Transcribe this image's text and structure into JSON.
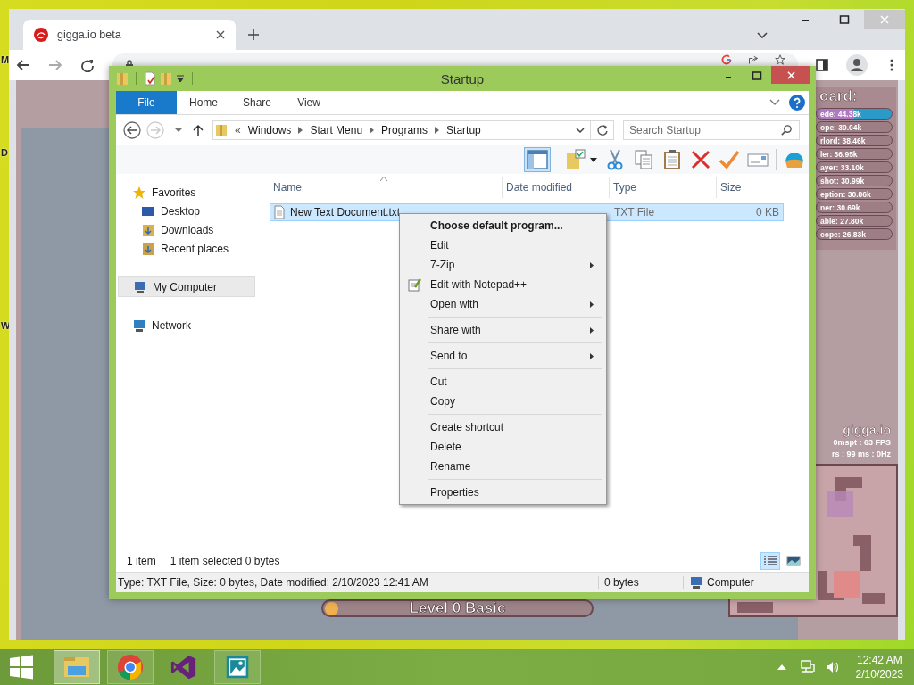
{
  "desktop": {
    "icon_labels": [
      "M",
      "D",
      "W"
    ]
  },
  "browser": {
    "tabs": [
      {
        "title": "gigga.io beta",
        "selected": true
      }
    ],
    "game": {
      "leaderboard": {
        "title": "oard:",
        "entries": [
          {
            "text": "ede: 44.38k",
            "selected": true
          },
          {
            "text": "ope: 39.04k",
            "selected": false
          },
          {
            "text": "rlord: 38.46k",
            "selected": false
          },
          {
            "text": "ler: 36.95k",
            "selected": false
          },
          {
            "text": "ayer: 33.10k",
            "selected": false
          },
          {
            "text": "shot: 30.99k",
            "selected": false
          },
          {
            "text": "eption: 30.86k",
            "selected": false
          },
          {
            "text": "ner: 30.69k",
            "selected": false
          },
          {
            "text": "able: 27.80k",
            "selected": false
          },
          {
            "text": "cope: 26.83k",
            "selected": false
          }
        ]
      },
      "brand": "gigga.io",
      "stats": [
        "0mspt : 63 FPS",
        "rs : 99 ms : 0Hz"
      ],
      "level_label": "Level 0 Basic"
    }
  },
  "explorer": {
    "title": "Startup",
    "ribbon_tabs": [
      {
        "label": "File",
        "selected": true
      },
      {
        "label": "Home",
        "selected": false
      },
      {
        "label": "Share",
        "selected": false
      },
      {
        "label": "View",
        "selected": false
      }
    ],
    "breadcrumb_overflow": "«",
    "breadcrumb": [
      "Windows",
      "Start Menu",
      "Programs",
      "Startup"
    ],
    "search": {
      "placeholder": "Search Startup"
    },
    "nav": [
      {
        "label": "Favorites",
        "kind": "favorites",
        "selected": false,
        "children": [
          {
            "label": "Desktop",
            "kind": "desktop",
            "selected": false
          },
          {
            "label": "Downloads",
            "kind": "downloads",
            "selected": false
          },
          {
            "label": "Recent places",
            "kind": "recent",
            "selected": false
          }
        ]
      },
      {
        "label": "My Computer",
        "kind": "computer",
        "selected": true
      },
      {
        "label": "Network",
        "kind": "network",
        "selected": false
      }
    ],
    "columns": [
      "Name",
      "Date modified",
      "Type",
      "Size"
    ],
    "files": [
      {
        "name": "New Text Document.txt",
        "type": "TXT File",
        "size": "0 KB",
        "selected": true
      }
    ],
    "item_count": "1 item",
    "selection_info": "1 item selected  0 bytes",
    "view_modes": [
      {
        "kind": "details",
        "selected": true
      },
      {
        "kind": "icons",
        "selected": false
      }
    ],
    "details": "Type: TXT File, Size: 0 bytes, Date modified: 2/10/2023 12:41 AM",
    "details_size": "0 bytes",
    "details_location": "Computer"
  },
  "context_menu": {
    "groups": [
      [
        {
          "label": "Choose default program...",
          "default": true,
          "submenu": false,
          "has_icon": false
        },
        {
          "label": "Edit",
          "default": false,
          "submenu": false,
          "has_icon": false
        },
        {
          "label": "7-Zip",
          "default": false,
          "submenu": true,
          "has_icon": false
        },
        {
          "label": "Edit with Notepad++",
          "default": false,
          "submenu": false,
          "has_icon": true
        },
        {
          "label": "Open with",
          "default": false,
          "submenu": true,
          "has_icon": false
        }
      ],
      [
        {
          "label": "Share with",
          "default": false,
          "submenu": true,
          "has_icon": false
        }
      ],
      [
        {
          "label": "Send to",
          "default": false,
          "submenu": true,
          "has_icon": false
        }
      ],
      [
        {
          "label": "Cut",
          "default": false,
          "submenu": false,
          "has_icon": false
        },
        {
          "label": "Copy",
          "default": false,
          "submenu": false,
          "has_icon": false
        }
      ],
      [
        {
          "label": "Create shortcut",
          "default": false,
          "submenu": false,
          "has_icon": false
        },
        {
          "label": "Delete",
          "default": false,
          "submenu": false,
          "has_icon": false
        },
        {
          "label": "Rename",
          "default": false,
          "submenu": false,
          "has_icon": false
        }
      ],
      [
        {
          "label": "Properties",
          "default": false,
          "submenu": false,
          "has_icon": false
        }
      ]
    ]
  },
  "taskbar": {
    "apps": [
      {
        "kind": "explorer",
        "running": true,
        "active": true
      },
      {
        "kind": "chrome",
        "running": true,
        "active": false
      },
      {
        "kind": "studio",
        "running": false,
        "active": false
      },
      {
        "kind": "photos",
        "running": true,
        "active": false
      }
    ],
    "time": "12:42 AM",
    "date": "2/10/2023"
  }
}
